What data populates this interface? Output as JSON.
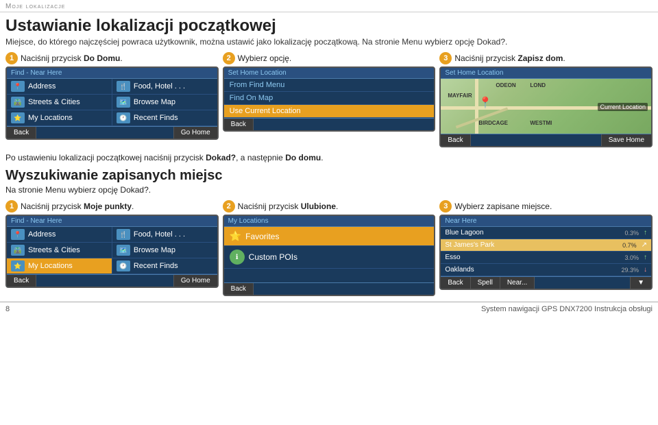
{
  "page": {
    "header": "Moje lokalizacje",
    "main_title": "Ustawianie lokalizacji początkowej",
    "subtitle": "Miejsce, do którego najczęściej powraca użytkownik, można ustawić jako lokalizację początkową. Na stronie Menu wybierz opcję Dokad?.",
    "between_text": "Po ustawieniu lokalizacji początkowej naciśnij przycisk Dokad?, a następnie Do domu.",
    "section2_title": "Wyszukiwanie zapisanych miejsc",
    "section2_sub": "Na stronie Menu wybierz opcję Dokad?.",
    "page_number": "8",
    "footer_text": "System nawigacji GPS DNX7200 Instrukcja obsługi"
  },
  "steps_row1": [
    {
      "num": "1",
      "label": "Naciśnij przycisk ",
      "label_bold": "Do Domu",
      "label_after": ".",
      "screen": {
        "title": "Find - Near Here",
        "col1": [
          {
            "icon": "📍",
            "text": "Address"
          },
          {
            "icon": "🗺️",
            "text": "Streets & Cities",
            "selected": false
          },
          {
            "icon": "⭐",
            "text": "My Locations",
            "selected": false
          }
        ],
        "col2": [
          {
            "icon": "🍴",
            "text": "Food, Hotel . . ."
          },
          {
            "icon": "🗺️",
            "text": "Browse Map"
          },
          {
            "icon": "🕐",
            "text": "Recent Finds"
          }
        ],
        "btn_left": "Back",
        "btn_right": "Go Home"
      }
    },
    {
      "num": "2",
      "label": "Wybierz opcję.",
      "label_bold": "",
      "screen": {
        "title": "Set Home Location",
        "options": [
          {
            "text": "From Find Menu",
            "selected": false
          },
          {
            "text": "Find On Map",
            "selected": false
          },
          {
            "text": "Use Current Location",
            "selected": true
          }
        ],
        "btn_left": "Back"
      }
    },
    {
      "num": "3",
      "label": "Naciśnij przycisk ",
      "label_bold": "Zapisz dom",
      "label_after": ".",
      "screen": {
        "title": "Set Home Location",
        "map_labels": [
          "ODEON",
          "MAYFAIR",
          "LOND",
          "BIRDCAGE",
          "WESTMI"
        ],
        "location_label": "Current Location",
        "btn_left": "Back",
        "btn_right": "Save Home"
      }
    }
  ],
  "steps_row2": [
    {
      "num": "1",
      "label": "Naciśnij przycisk ",
      "label_bold": "Moje punkty",
      "label_after": ".",
      "screen": {
        "title": "Find - Near Here",
        "col1": [
          {
            "icon": "📍",
            "text": "Address"
          },
          {
            "icon": "🗺️",
            "text": "Streets & Cities",
            "selected": false
          },
          {
            "icon": "⭐",
            "text": "My Locations",
            "selected": true
          }
        ],
        "col2": [
          {
            "icon": "🍴",
            "text": "Food, Hotel . . ."
          },
          {
            "icon": "🗺️",
            "text": "Browse Map"
          },
          {
            "icon": "🕐",
            "text": "Recent Finds"
          }
        ],
        "btn_left": "Back",
        "btn_right": "Go Home"
      }
    },
    {
      "num": "2",
      "label": "Naciśnij przycisk ",
      "label_bold": "Ulubione",
      "label_after": ".",
      "screen": {
        "title": "My Locations",
        "favorites": {
          "icon": "⭐",
          "text": "Favorites",
          "selected": true
        },
        "custom": {
          "icon": "ℹ️",
          "text": "Custom POIs"
        },
        "btn_left": "Back"
      }
    },
    {
      "num": "3",
      "label": "Wybierz zapisane miejsce.",
      "label_bold": "",
      "screen": {
        "title": "Near Here",
        "items": [
          {
            "name": "Blue Lagoon",
            "dist": "0.3%",
            "dir": "up",
            "selected": false
          },
          {
            "name": "St James's Park",
            "dist": "0.7%",
            "dir": "up",
            "selected": true
          },
          {
            "name": "Esso",
            "dist": "3.0%",
            "dir": "up",
            "selected": false
          },
          {
            "name": "Oaklands",
            "dist": "29.3%",
            "dir": "down",
            "selected": false
          }
        ],
        "btn_left": "Back",
        "btn_mid1": "Spell",
        "btn_mid2": "Near...",
        "btn_right": "▼"
      }
    }
  ],
  "screen_labels": {
    "find_near_here": "Find - Near Here",
    "set_home": "Set Home Location",
    "my_locations": "My Locations",
    "near_here": "Near Here",
    "address": "Address",
    "food_hotel": "Food, Hotel . . .",
    "streets_cities": "Streets & Cities",
    "browse_map": "Browse Map",
    "my_locations_item": "My Locations",
    "recent_finds": "Recent Finds",
    "back": "Back",
    "go_home": "Go Home",
    "save_home": "Save Home",
    "from_find_menu": "From Find Menu",
    "find_on_map": "Find On Map",
    "use_current_location": "Use Current Location",
    "current_location": "Current Location",
    "favorites": "Favorites",
    "custom_pois": "Custom POIs",
    "blue_lagoon": "Blue Lagoon",
    "st_james": "St James's Park",
    "esso": "Esso",
    "oaklands": "Oaklands",
    "spell": "Spell",
    "near": "Near..."
  }
}
